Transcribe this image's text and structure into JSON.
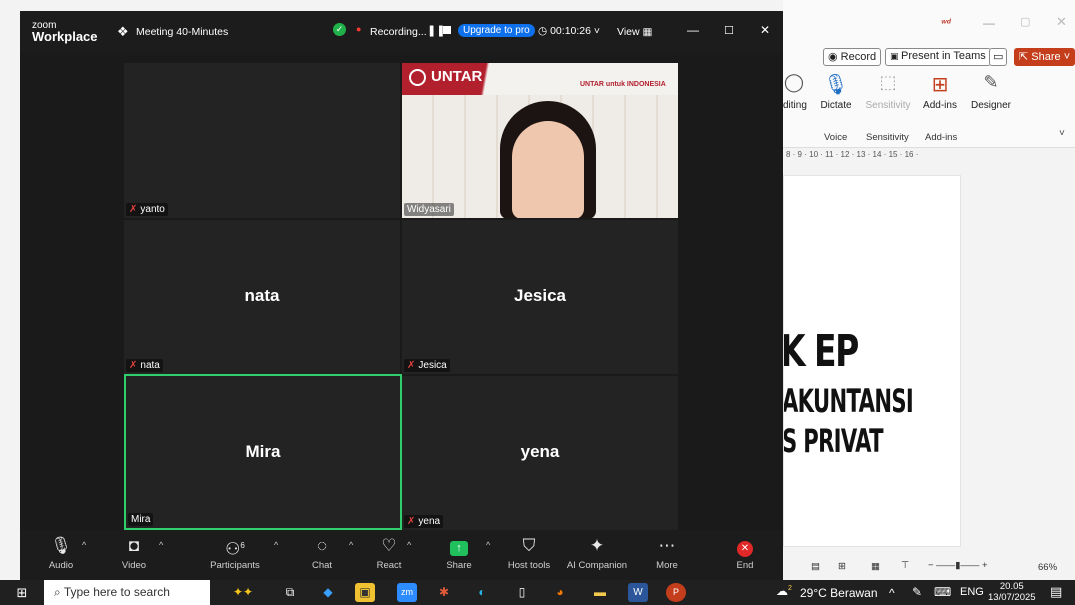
{
  "powerpoint": {
    "top_buttons": [
      "Record",
      "Present in Teams",
      "Share"
    ],
    "ribbon_items": [
      "diting",
      "Dictate",
      "Sensitivity",
      "Add-ins",
      "Designer"
    ],
    "ribbon_groups": [
      "Voice",
      "Sensitivity",
      "Add-ins"
    ],
    "ruler": "8 · 9 · 10 · 11 · 12 · 13 · 14 · 15 · 16 ·",
    "slide_line1": "K EP",
    "slide_line2": "AKUNTANSI",
    "slide_line3": "S PRIVAT",
    "zoom_level": "66%"
  },
  "zoom": {
    "brand_line1": "zoom",
    "brand_line2": "Workplace",
    "meeting_title": "Meeting 40-Minutes",
    "recording_label": "Recording...",
    "upgrade_label": "Upgrade to pro",
    "timer": "00:10:26",
    "view_label": "View",
    "participants": [
      {
        "name": "yanto",
        "label": "yanto",
        "muted": true,
        "video": false
      },
      {
        "name": "Widyasari",
        "label": "Widyasari",
        "muted": false,
        "video": true
      },
      {
        "name": "nata",
        "label": "nata",
        "muted": true,
        "video": false
      },
      {
        "name": "Jesica",
        "label": "Jesica",
        "muted": true,
        "video": false
      },
      {
        "name": "Mira",
        "label": "Mira",
        "muted": false,
        "video": false,
        "speaking": true
      },
      {
        "name": "yena",
        "label": "yena",
        "muted": true,
        "video": false
      }
    ],
    "banner_brand": "UNTAR",
    "banner_slogan": "UNTAR untuk INDONESIA",
    "toolbar": {
      "audio": "Audio",
      "video": "Video",
      "participants": "Participants",
      "participants_count": "6",
      "chat": "Chat",
      "react": "React",
      "share": "Share",
      "host_tools": "Host tools",
      "ai_companion": "AI Companion",
      "more": "More",
      "end": "End"
    }
  },
  "taskbar": {
    "search_placeholder": "Type here to search",
    "weather": "29°C Berawan",
    "language": "ENG",
    "time": "20.05",
    "date": "13/07/2025",
    "weather_badge": "2"
  },
  "colors": {
    "zoom_bg": "#1a1a1a",
    "tile_bg": "#232323",
    "speaking_border": "#2fd06b",
    "upgrade": "#0e71eb",
    "share_green": "#20c05c",
    "end_red": "#e02828",
    "share_ppt": "#c43e1c"
  }
}
